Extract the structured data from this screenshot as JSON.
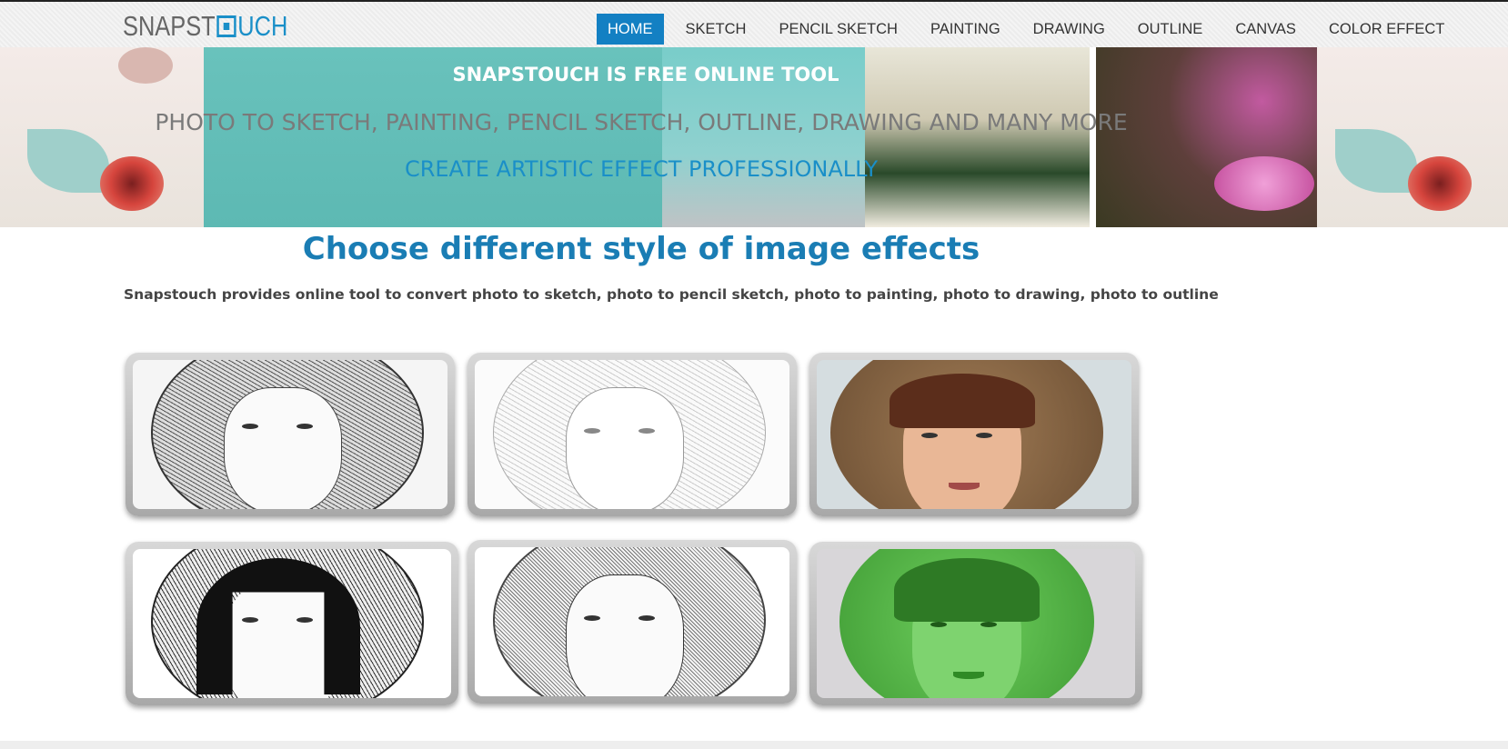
{
  "logo": {
    "part1": "SNAPST",
    "part2": "UCH"
  },
  "nav": {
    "items": [
      {
        "label": "HOME",
        "active": true
      },
      {
        "label": "SKETCH"
      },
      {
        "label": "PENCIL SKETCH"
      },
      {
        "label": "PAINTING"
      },
      {
        "label": "DRAWING"
      },
      {
        "label": "OUTLINE"
      },
      {
        "label": "CANVAS"
      },
      {
        "label": "COLOR EFFECT"
      }
    ]
  },
  "banner": {
    "line1": "SNAPSTOUCH IS FREE ONLINE TOOL",
    "line2": "PHOTO TO SKETCH, PAINTING, PENCIL SKETCH, OUTLINE, DRAWING AND MANY MORE",
    "line3": "CREATE ARTISTIC EFFECT PROFESSIONALLY"
  },
  "main": {
    "heading": "Choose different style of image effects",
    "description": "Snapstouch provides online tool to convert photo to sketch, photo to pencil sketch, photo to painting, photo to drawing, photo to outline"
  },
  "colors": {
    "accent": "#1380c3",
    "heading": "#1a7db4",
    "banner_teal": "#5db9b3"
  }
}
